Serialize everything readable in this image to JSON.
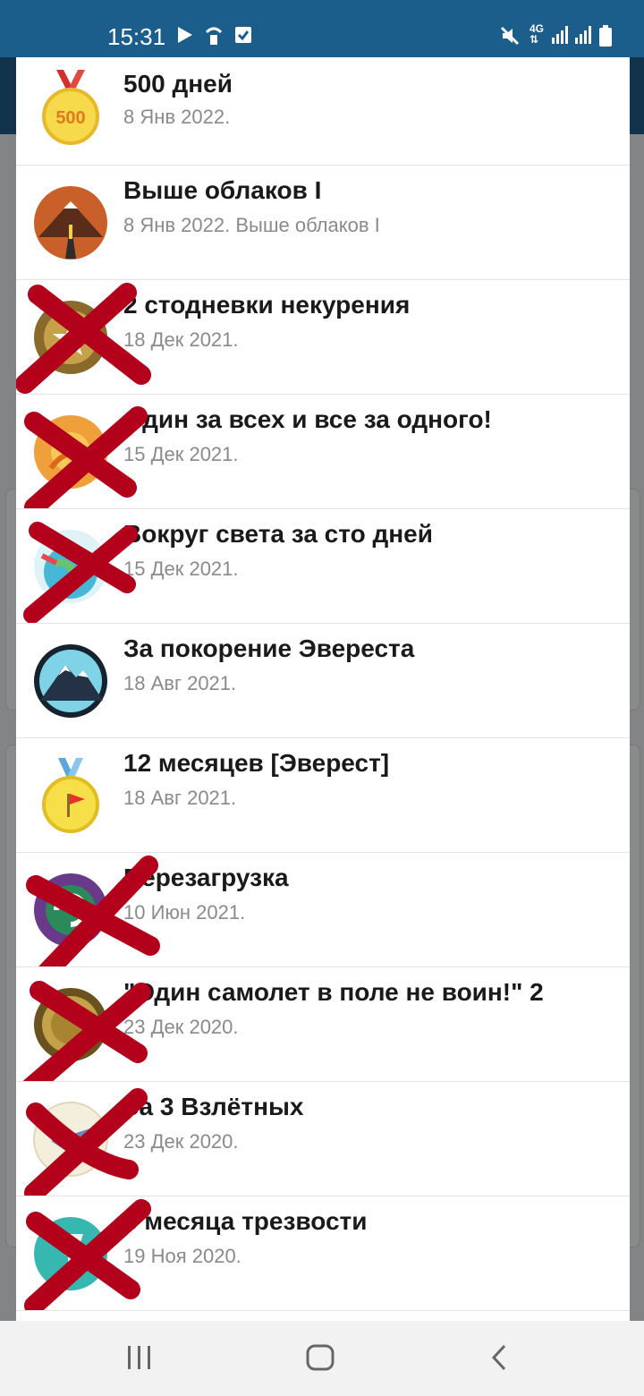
{
  "status_bar": {
    "time": "15:31",
    "network_label": "4G",
    "left_icons": [
      "play-store-icon",
      "wifi-hotspot-icon",
      "task-check-icon"
    ],
    "right_icons": [
      "mute-icon",
      "network-4g-icon",
      "signal-icon",
      "signal-icon",
      "battery-icon"
    ],
    "background_color": "#1b5e8c"
  },
  "achievements": [
    {
      "title": "500 дней",
      "subtitle": "8 Янв 2022.",
      "icon": "medal-500-icon",
      "crossed": false
    },
    {
      "title": "Выше облаков I",
      "subtitle": "8 Янв 2022. Выше облаков I",
      "icon": "mountain-road-icon",
      "crossed": false
    },
    {
      "title": "2 стодневки некурения",
      "subtitle": "18 Дек 2021.",
      "icon": "star-badge-icon",
      "crossed": true
    },
    {
      "title": "Один за всех и все за одного!",
      "subtitle": "15 Дек 2021.",
      "icon": "sun-badge-icon",
      "crossed": true
    },
    {
      "title": "Вокруг света за сто дней",
      "subtitle": "15 Дек 2021.",
      "icon": "globe-icon",
      "crossed": true
    },
    {
      "title": "За покорение Эвереста",
      "subtitle": "18 Авг 2021.",
      "icon": "everest-icon",
      "crossed": false
    },
    {
      "title": "12 месяцев [Эверест]",
      "subtitle": "18 Авг 2021.",
      "icon": "medal-flag-icon",
      "crossed": false
    },
    {
      "title": "Перезагрузка",
      "subtitle": "10 Июн 2021.",
      "icon": "reload-icon",
      "crossed": true
    },
    {
      "title": "\"Один самолет в поле не воин!\" 2",
      "subtitle": "23 Дек 2020.",
      "icon": "coin-icon",
      "crossed": true
    },
    {
      "title": "За 3 Взлётных",
      "subtitle": "23 Дек 2020.",
      "icon": "plane-badge-icon",
      "crossed": true
    },
    {
      "title": "3 месяца трезвости",
      "subtitle": "19 Ноя 2020.",
      "icon": "glass-icon",
      "crossed": true
    }
  ],
  "colors": {
    "cross": "#b3001b",
    "title": "#1a1a1a",
    "subtitle": "#8a8a8a",
    "divider": "#e3e3e3"
  },
  "nav_bar": {
    "icons": [
      "recent-apps-icon",
      "home-icon",
      "back-icon"
    ]
  }
}
